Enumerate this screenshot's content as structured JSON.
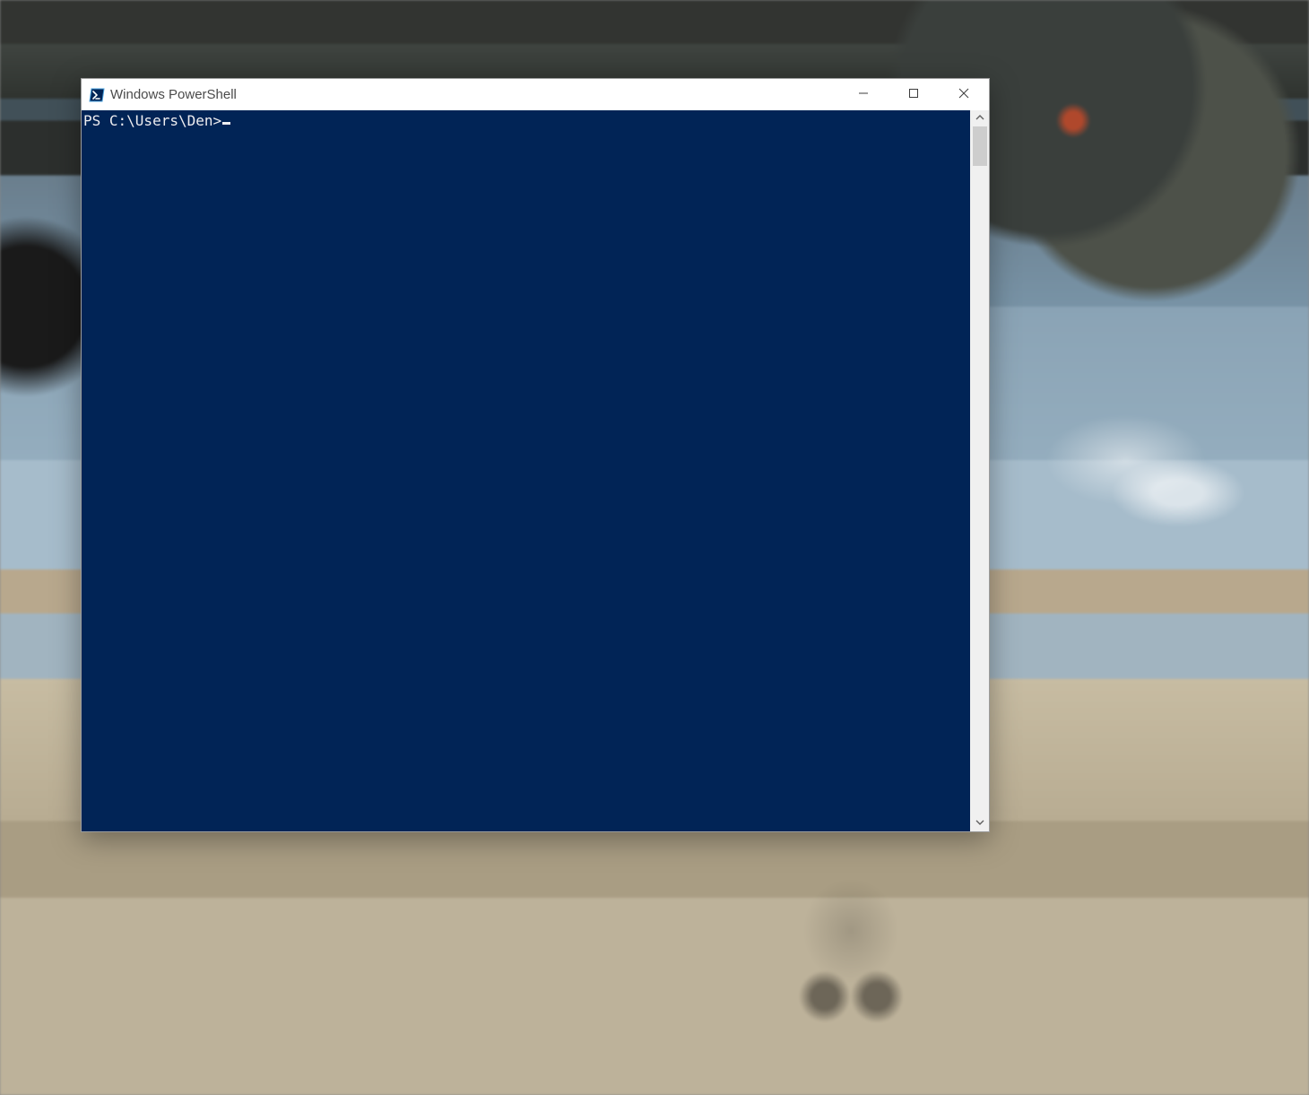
{
  "window": {
    "title": "Windows PowerShell",
    "icon_name": "powershell-icon"
  },
  "terminal": {
    "prompt": "PS C:\\Users\\Den>",
    "background_color": "#012456",
    "foreground_color": "#eeedf0"
  }
}
